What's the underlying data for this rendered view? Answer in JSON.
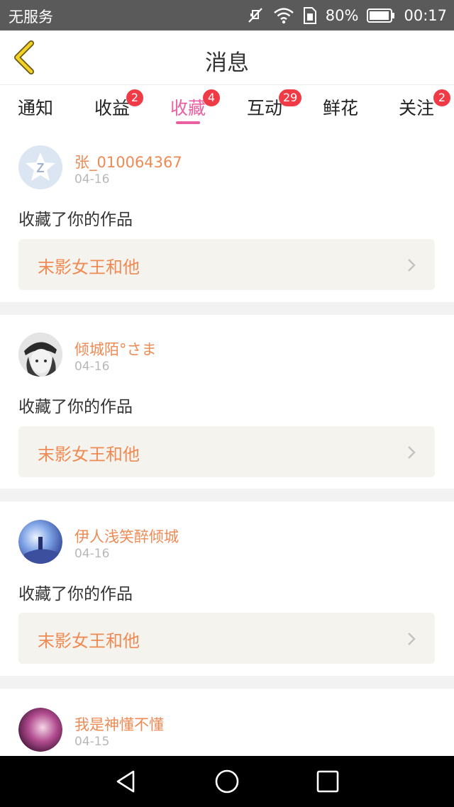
{
  "status_bar": {
    "carrier": "无服务",
    "battery": "80%",
    "time": "00:17",
    "icons": [
      "mute-icon",
      "wifi-icon",
      "sim-icon",
      "battery-icon"
    ]
  },
  "header": {
    "title": "消息",
    "back_icon": "chevron-left-icon",
    "accent": "#e8c51e"
  },
  "tabs": [
    {
      "label": "通知",
      "badge": ""
    },
    {
      "label": "收益",
      "badge": "2"
    },
    {
      "label": "收藏",
      "badge": "4",
      "active": true
    },
    {
      "label": "互动",
      "badge": "29"
    },
    {
      "label": "鲜花",
      "badge": ""
    },
    {
      "label": "关注",
      "badge": "2"
    }
  ],
  "messages": [
    {
      "username": "张_010064367",
      "date": "04-16",
      "action": "收藏了你的作品",
      "work_title": "末影女王和他"
    },
    {
      "username": "倾城陌°さま",
      "date": "04-16",
      "action": "收藏了你的作品",
      "work_title": "末影女王和他"
    },
    {
      "username": "伊人浅笑醉倾城",
      "date": "04-16",
      "action": "收藏了你的作品",
      "work_title": "末影女王和他"
    },
    {
      "username": "我是神懂不懂",
      "date": "04-15"
    }
  ],
  "nav_bar": {
    "icons": [
      "back-triangle-icon",
      "home-circle-icon",
      "recents-square-icon"
    ]
  },
  "colors": {
    "active_tab": "#ea5f9f",
    "badge": "#f03a46",
    "username": "#ee8a54",
    "work_card_bg": "#f5f3ed"
  }
}
